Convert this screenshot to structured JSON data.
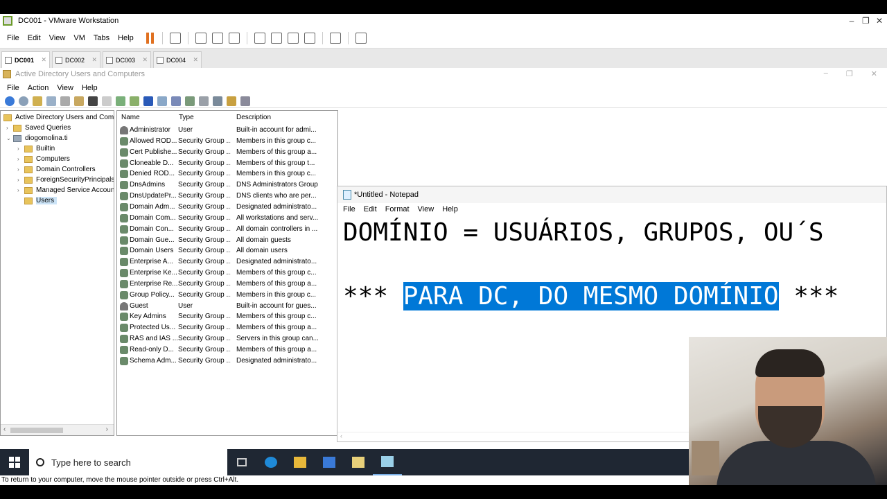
{
  "vmware": {
    "title": "DC001 - VMware Workstation",
    "menu": [
      "File",
      "Edit",
      "View",
      "VM",
      "Tabs",
      "Help"
    ],
    "tabs": [
      "DC001",
      "DC002",
      "DC003",
      "DC004"
    ],
    "status": "To return to your computer, move the mouse pointer outside or press Ctrl+Alt."
  },
  "aduc": {
    "title": "Active Directory Users and Computers",
    "menu": [
      "File",
      "Action",
      "View",
      "Help"
    ],
    "tree": {
      "root": "Active Directory Users and Comp",
      "saved_queries": "Saved Queries",
      "domain": "diogomolina.ti",
      "children": [
        "Builtin",
        "Computers",
        "Domain Controllers",
        "ForeignSecurityPrincipals",
        "Managed Service Accoun",
        "Users"
      ]
    },
    "columns": [
      "Name",
      "Type",
      "Description"
    ],
    "rows": [
      {
        "name": "Administrator",
        "type": "User",
        "desc": "Built-in account for admi...",
        "kind": "user"
      },
      {
        "name": "Allowed ROD...",
        "type": "Security Group ...",
        "desc": "Members in this group c...",
        "kind": "group"
      },
      {
        "name": "Cert Publishe...",
        "type": "Security Group ...",
        "desc": "Members of this group a...",
        "kind": "group"
      },
      {
        "name": "Cloneable D...",
        "type": "Security Group ...",
        "desc": "Members of this group t...",
        "kind": "group"
      },
      {
        "name": "Denied ROD...",
        "type": "Security Group ...",
        "desc": "Members in this group c...",
        "kind": "group"
      },
      {
        "name": "DnsAdmins",
        "type": "Security Group ...",
        "desc": "DNS Administrators Group",
        "kind": "group"
      },
      {
        "name": "DnsUpdatePr...",
        "type": "Security Group ...",
        "desc": "DNS clients who are per...",
        "kind": "group"
      },
      {
        "name": "Domain Adm...",
        "type": "Security Group ...",
        "desc": "Designated administrato...",
        "kind": "group"
      },
      {
        "name": "Domain Com...",
        "type": "Security Group ...",
        "desc": "All workstations and serv...",
        "kind": "group"
      },
      {
        "name": "Domain Con...",
        "type": "Security Group ...",
        "desc": "All domain controllers in ...",
        "kind": "group"
      },
      {
        "name": "Domain Gue...",
        "type": "Security Group ...",
        "desc": "All domain guests",
        "kind": "group"
      },
      {
        "name": "Domain Users",
        "type": "Security Group ...",
        "desc": "All domain users",
        "kind": "group"
      },
      {
        "name": "Enterprise A...",
        "type": "Security Group ...",
        "desc": "Designated administrato...",
        "kind": "group"
      },
      {
        "name": "Enterprise Ke...",
        "type": "Security Group ...",
        "desc": "Members of this group c...",
        "kind": "group"
      },
      {
        "name": "Enterprise Re...",
        "type": "Security Group ...",
        "desc": "Members of this group a...",
        "kind": "group"
      },
      {
        "name": "Group Policy...",
        "type": "Security Group ...",
        "desc": "Members in this group c...",
        "kind": "group"
      },
      {
        "name": "Guest",
        "type": "User",
        "desc": "Built-in account for gues...",
        "kind": "user"
      },
      {
        "name": "Key Admins",
        "type": "Security Group ...",
        "desc": "Members of this group c...",
        "kind": "group"
      },
      {
        "name": "Protected Us...",
        "type": "Security Group ...",
        "desc": "Members of this group a...",
        "kind": "group"
      },
      {
        "name": "RAS and IAS ...",
        "type": "Security Group ...",
        "desc": "Servers in this group can...",
        "kind": "group"
      },
      {
        "name": "Read-only D...",
        "type": "Security Group ...",
        "desc": "Members of this group a...",
        "kind": "group"
      },
      {
        "name": "Schema Adm...",
        "type": "Security Group ...",
        "desc": "Designated administrato...",
        "kind": "group"
      }
    ]
  },
  "notepad": {
    "title": "*Untitled - Notepad",
    "menu": [
      "File",
      "Edit",
      "Format",
      "View",
      "Help"
    ],
    "line1": "DOMÍNIO = USUÁRIOS, GRUPOS, OU´S",
    "line2_pre": "*** ",
    "line2_selected": "PARA DC, DO MESMO DOMÍNIO",
    "line2_post": " ***",
    "selection_color": "#0078d7"
  },
  "taskbar": {
    "search_placeholder": "Type here to search",
    "icons": [
      "task-view-icon",
      "edge-icon",
      "file-explorer-icon",
      "server-manager-icon",
      "ad-users-icon",
      "notepad-icon"
    ]
  }
}
